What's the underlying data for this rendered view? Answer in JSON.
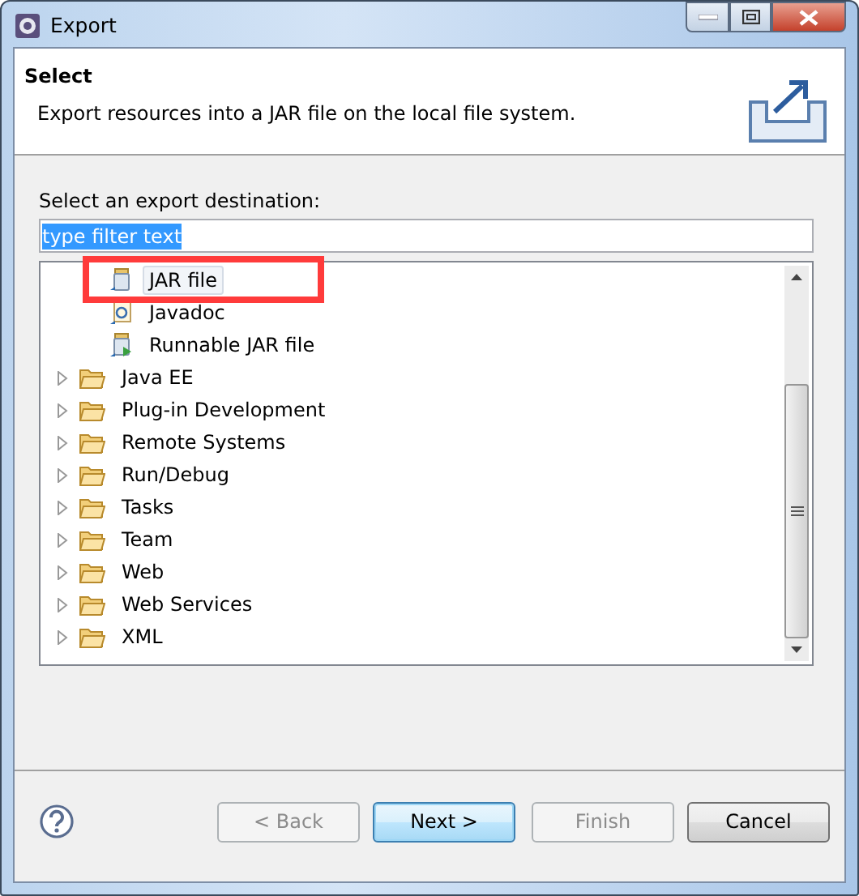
{
  "window": {
    "title": "Export"
  },
  "header": {
    "title": "Select",
    "description": "Export resources into a JAR file on the local file system."
  },
  "destination_label": "Select an export destination:",
  "filter": {
    "value": "type filter text",
    "text_selected": true
  },
  "tree": {
    "continued_children": [
      {
        "label": "JAR file",
        "kind": "jar",
        "selected": true
      },
      {
        "label": "Javadoc",
        "kind": "javadoc",
        "selected": false
      },
      {
        "label": "Runnable JAR file",
        "kind": "runnable-jar",
        "selected": false
      }
    ],
    "items": [
      {
        "label": "Java EE",
        "expanded": false
      },
      {
        "label": "Plug-in Development",
        "expanded": false
      },
      {
        "label": "Remote Systems",
        "expanded": false
      },
      {
        "label": "Run/Debug",
        "expanded": false
      },
      {
        "label": "Tasks",
        "expanded": false
      },
      {
        "label": "Team",
        "expanded": false
      },
      {
        "label": "Web",
        "expanded": false
      },
      {
        "label": "Web Services",
        "expanded": false
      },
      {
        "label": "XML",
        "expanded": false
      }
    ]
  },
  "buttons": [
    {
      "label": "< Back",
      "disabled": true,
      "default": false
    },
    {
      "label": "Next >",
      "disabled": false,
      "default": true
    },
    {
      "label": "Finish",
      "disabled": true,
      "default": false
    },
    {
      "label": "Cancel",
      "disabled": false,
      "default": false
    }
  ]
}
